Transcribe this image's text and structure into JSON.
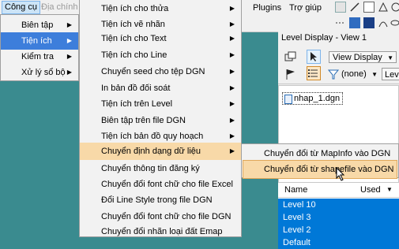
{
  "menubar": {
    "items": [
      {
        "label": "Công cụ"
      },
      {
        "label": "Địa chính"
      },
      {
        "label": "Plugins"
      },
      {
        "label": "Trợ giúp"
      }
    ]
  },
  "left_menu": {
    "items": [
      {
        "label": "Biên tập",
        "arrow": "▶"
      },
      {
        "label": "Tiện ích",
        "arrow": "▶"
      },
      {
        "label": "Kiểm tra",
        "arrow": "▶"
      },
      {
        "label": "Xử lý sổ bộ",
        "arrow": "▶"
      }
    ]
  },
  "sub_menu": {
    "items": [
      {
        "label": "Tiện ích cho thửa",
        "arrow": "▶"
      },
      {
        "label": "Tiện ích vẽ nhãn",
        "arrow": "▶"
      },
      {
        "label": "Tiện ích cho Text",
        "arrow": "▶"
      },
      {
        "label": "Tiện ích cho Line",
        "arrow": "▶"
      },
      {
        "label": "Chuyển seed cho tệp DGN",
        "arrow": "▶"
      },
      {
        "label": "In bản đồ đối soát",
        "arrow": "▶"
      },
      {
        "label": "Tiện ích trên Level",
        "arrow": "▶"
      },
      {
        "label": "Biên tập trên file DGN",
        "arrow": "▶"
      },
      {
        "label": "Tiện ích bản đồ quy hoạch",
        "arrow": "▶"
      },
      {
        "label": "Chuyển định dạng dữ liệu",
        "arrow": "▶"
      },
      {
        "label": "Chuyển thông tin đăng ký",
        "arrow": ""
      },
      {
        "label": "Chuyển đổi font chữ cho file Excel",
        "arrow": ""
      },
      {
        "label": "Đổi Line Style trong file DGN",
        "arrow": ""
      },
      {
        "label": "Chuyển đổi font chữ cho file DGN",
        "arrow": ""
      },
      {
        "label": "Chuyển đổi nhãn loại đất Emap",
        "arrow": ""
      }
    ]
  },
  "third_menu": {
    "items": [
      {
        "label": "Chuyển đổi từ MapInfo vào DGN"
      },
      {
        "label": "Chuyển đổi từ shapefile vào DGN"
      }
    ]
  },
  "level_display": {
    "title": "Level Display - View 1",
    "view_mode": "View Display",
    "filter": "(none)",
    "level_button": "Leve",
    "file": "nhap_1.dgn",
    "columns": {
      "name": "Name",
      "used": "Used"
    },
    "levels": [
      "Level 10",
      "Level 3",
      "Level 2",
      "Default"
    ]
  },
  "colors": {
    "accent": "#3d7edb",
    "background": "#3a8b8f",
    "selection": "#0078d7"
  }
}
